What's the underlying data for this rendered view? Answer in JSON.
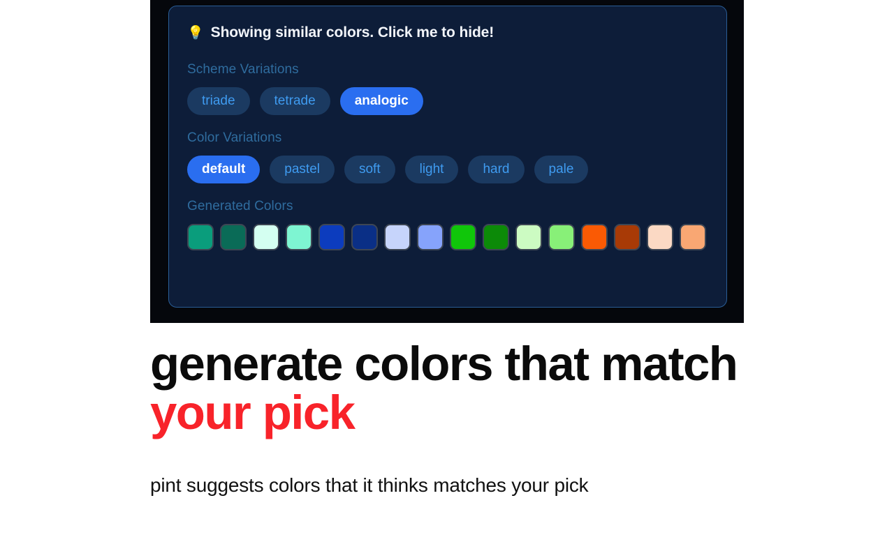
{
  "screenshot": {
    "banner": {
      "icon": "lightbulb-icon",
      "icon_glyph": "💡",
      "text": "Showing similar colors. Click me to hide!"
    },
    "scheme_variations": {
      "label": "Scheme Variations",
      "options": [
        {
          "label": "triade",
          "active": false
        },
        {
          "label": "tetrade",
          "active": false
        },
        {
          "label": "analogic",
          "active": true
        }
      ]
    },
    "color_variations": {
      "label": "Color Variations",
      "options": [
        {
          "label": "default",
          "active": true
        },
        {
          "label": "pastel",
          "active": false
        },
        {
          "label": "soft",
          "active": false
        },
        {
          "label": "light",
          "active": false
        },
        {
          "label": "hard",
          "active": false
        },
        {
          "label": "pale",
          "active": false
        }
      ]
    },
    "generated_colors": {
      "label": "Generated Colors",
      "swatches": [
        "#0a9d7c",
        "#0a6b57",
        "#d4fff1",
        "#7ef5d2",
        "#0c3cbe",
        "#0a2f86",
        "#c6d4fb",
        "#86a3fb",
        "#10c60a",
        "#0c8a08",
        "#ccfbc2",
        "#88f078",
        "#fa5a04",
        "#a83a06",
        "#fbd9c4",
        "#f9a773"
      ]
    },
    "theme": {
      "page_background": "#05070c",
      "panel_background": "#0d1d39",
      "panel_border": "#2a5d96",
      "pill_active_bg": "#2a6ef0",
      "pill_inactive_bg": "#1b3a61",
      "pill_inactive_text": "#3f9bf0",
      "section_label_color": "#2f6c9e"
    }
  },
  "content": {
    "headline_line1": "generate colors that match",
    "headline_line2": "your pick",
    "headline_accent_color": "#f8232a",
    "subtitle": "pint suggests colors that it thinks matches your pick"
  }
}
